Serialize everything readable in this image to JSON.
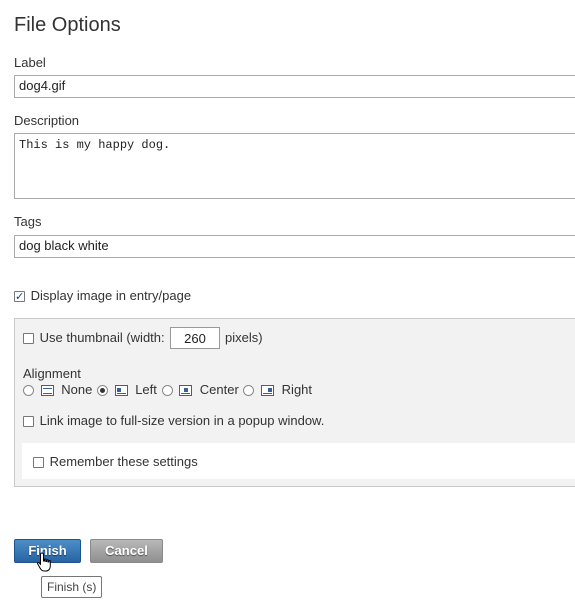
{
  "page": {
    "title": "File Options"
  },
  "label_field": {
    "label": "Label",
    "value": "dog4.gif"
  },
  "description_field": {
    "label": "Description",
    "value": "This is my happy dog."
  },
  "tags_field": {
    "label": "Tags",
    "value": "dog black white"
  },
  "display_image": {
    "label": "Display image in entry/page",
    "checked": true
  },
  "options": {
    "thumbnail": {
      "label_prefix": "Use thumbnail (width:",
      "width_value": "260",
      "label_suffix": "pixels)",
      "checked": false
    },
    "alignment": {
      "label": "Alignment",
      "options": [
        {
          "label": "None",
          "icon": "align-none-icon",
          "selected": false
        },
        {
          "label": "Left",
          "icon": "align-left-icon",
          "selected": true
        },
        {
          "label": "Center",
          "icon": "align-center-icon",
          "selected": false
        },
        {
          "label": "Right",
          "icon": "align-right-icon",
          "selected": false
        }
      ]
    },
    "popup_link": {
      "label": "Link image to full-size version in a popup window.",
      "checked": false
    },
    "remember": {
      "label": "Remember these settings",
      "checked": false
    }
  },
  "buttons": {
    "finish": "Finish",
    "cancel": "Cancel"
  },
  "tooltip": {
    "text": "Finish (s)"
  },
  "colors": {
    "finish_button": "#2f72b3",
    "cancel_button": "#a0a0a0",
    "panel_bg": "#f2f2f2"
  }
}
